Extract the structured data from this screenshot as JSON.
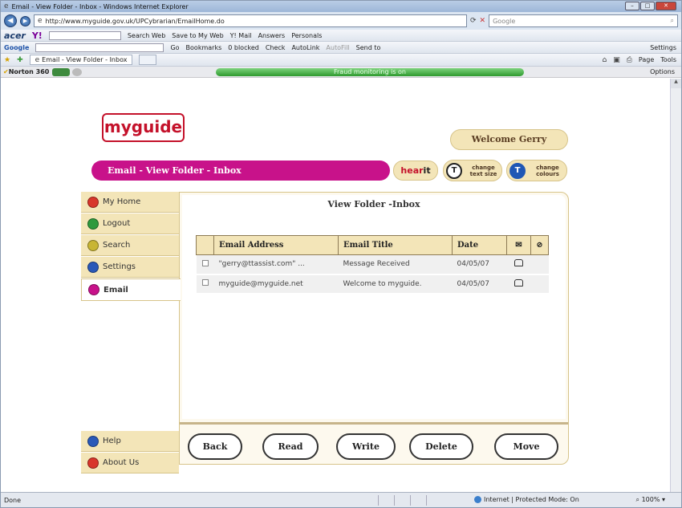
{
  "window": {
    "title": "Email - View Folder - Inbox - Windows Internet Explorer",
    "buttons": {
      "min": "–",
      "max": "□",
      "close": "✕"
    }
  },
  "address_bar": {
    "url": "http://www.myguide.gov.uk/UPCybrarian/EmailHome.do",
    "search_placeholder": "Google"
  },
  "toolbar1": {
    "brand": "acer",
    "yahoo": "Y!",
    "search_web": "Search Web",
    "save_to_my_web": "Save to My Web",
    "ymail": "Y! Mail",
    "answers": "Answers",
    "personals": "Personals"
  },
  "toolbar2": {
    "google": "Google",
    "go": "Go",
    "bookmarks": "Bookmarks",
    "blocked": "0 blocked",
    "check": "Check",
    "autolink": "AutoLink",
    "autofill": "AutoFill",
    "send_to": "Send to",
    "settings": "Settings"
  },
  "toolbar3": {
    "tab_label": "Email - View Folder - Inbox",
    "page": "Page",
    "tools": "Tools"
  },
  "norton": {
    "label": "Norton 360",
    "fraud": "Fraud monitoring is on",
    "options": "Options"
  },
  "page": {
    "logo_my": "my",
    "logo_guide": "guide",
    "welcome": "Welcome Gerry",
    "banner": "Email - View Folder - Inbox",
    "hearit_hear": "hear",
    "hearit_it": "it",
    "change_text_size": "change text size",
    "change_colours": "change colours",
    "nav": [
      {
        "label": "My Home",
        "color": "#d8362b"
      },
      {
        "label": "Logout",
        "color": "#2e9a3e"
      },
      {
        "label": "Search",
        "color": "#c8b534"
      },
      {
        "label": "Settings",
        "color": "#2a59b8"
      },
      {
        "label": "Email",
        "color": "#c8128a"
      }
    ],
    "nav_bottom": [
      {
        "label": "Help",
        "color": "#2a59b8"
      },
      {
        "label": "About Us",
        "color": "#d8362b"
      }
    ],
    "panel_title": "View Folder -Inbox",
    "table": {
      "headers": [
        "Email Address",
        "Email Title",
        "Date"
      ],
      "rows": [
        {
          "address": "\"gerry@ttassist.com\" ...",
          "title": "Message Received",
          "date": "04/05/07"
        },
        {
          "address": "myguide@myguide.net",
          "title": "Welcome to myguide.",
          "date": "04/05/07"
        }
      ]
    },
    "buttons": [
      "Back",
      "Read",
      "Write",
      "Delete",
      "Move"
    ]
  },
  "status": {
    "left": "Done",
    "zone": "Internet | Protected Mode: On",
    "zoom": "100%"
  }
}
